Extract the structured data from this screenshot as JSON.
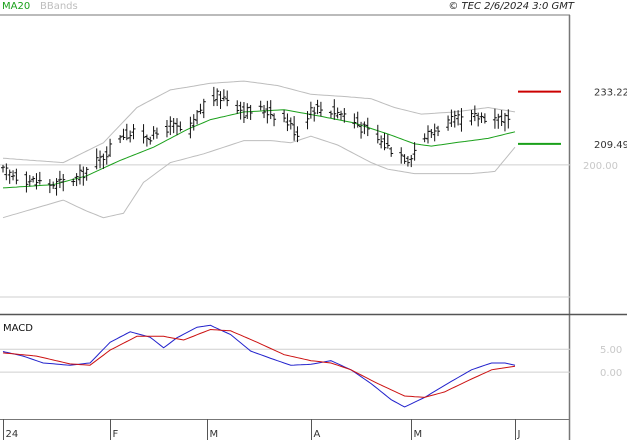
{
  "header": {
    "legend_ma": "MA20",
    "legend_bb": "BBands",
    "timestamp": "© TEC 2/6/2024 3:0 GMT"
  },
  "colors": {
    "ma": "#1aa01a",
    "bbands": "#bdbdbd",
    "price_bar": "#111111",
    "resistance": "#cc0000",
    "support": "#1aa01a",
    "macd_line": "#2222cc",
    "signal_line": "#cc1111",
    "grid": "#cfcfcf",
    "frame": "#777777"
  },
  "chart_data": [
    {
      "type": "ohlc",
      "title": "",
      "ylim": [
        140,
        268
      ],
      "y_ticks": [
        {
          "value": 200,
          "label": "200.00"
        }
      ],
      "x_ticks": [
        {
          "day": 0,
          "label": "24"
        },
        {
          "day": 32,
          "label": "F"
        },
        {
          "day": 61,
          "label": "M"
        },
        {
          "day": 92,
          "label": "A"
        },
        {
          "day": 122,
          "label": "M"
        },
        {
          "day": 153,
          "label": "J"
        }
      ],
      "levels": [
        {
          "name": "resistance",
          "value": 233.22,
          "label": "233.22"
        },
        {
          "name": "support",
          "value": 209.49,
          "label": "209.49"
        }
      ],
      "close_path": [
        [
          0,
          197
        ],
        [
          8,
          193
        ],
        [
          15,
          191
        ],
        [
          22,
          194
        ],
        [
          30,
          204
        ],
        [
          35,
          214
        ],
        [
          40,
          214
        ],
        [
          45,
          213
        ],
        [
          50,
          218
        ],
        [
          55,
          214
        ],
        [
          60,
          228
        ],
        [
          64,
          231
        ],
        [
          68,
          230
        ],
        [
          72,
          224
        ],
        [
          78,
          225
        ],
        [
          84,
          221
        ],
        [
          88,
          214
        ],
        [
          92,
          226
        ],
        [
          97,
          225
        ],
        [
          102,
          223
        ],
        [
          108,
          216
        ],
        [
          114,
          209
        ],
        [
          121,
          203
        ],
        [
          126,
          213
        ],
        [
          132,
          219
        ],
        [
          138,
          221
        ],
        [
          144,
          222
        ],
        [
          150,
          221
        ],
        [
          153,
          217
        ]
      ],
      "ma20_path": [
        [
          0,
          189.5
        ],
        [
          15,
          191
        ],
        [
          25,
          195
        ],
        [
          35,
          202
        ],
        [
          45,
          208
        ],
        [
          55,
          216
        ],
        [
          62,
          220.5
        ],
        [
          72,
          224
        ],
        [
          84,
          225
        ],
        [
          95,
          222
        ],
        [
          105,
          219
        ],
        [
          115,
          214
        ],
        [
          123,
          209.5
        ],
        [
          128,
          208.5
        ],
        [
          135,
          210
        ],
        [
          145,
          212
        ],
        [
          153,
          215
        ]
      ],
      "bb_upper_path": [
        [
          0,
          203
        ],
        [
          18,
          201
        ],
        [
          30,
          210
        ],
        [
          40,
          226
        ],
        [
          50,
          234
        ],
        [
          62,
          237
        ],
        [
          72,
          238
        ],
        [
          82,
          236
        ],
        [
          92,
          232
        ],
        [
          102,
          231
        ],
        [
          110,
          230
        ],
        [
          117,
          226
        ],
        [
          125,
          223
        ],
        [
          135,
          224
        ],
        [
          145,
          226
        ],
        [
          153,
          224
        ]
      ],
      "bb_lower_path": [
        [
          0,
          176
        ],
        [
          18,
          184
        ],
        [
          25,
          179
        ],
        [
          30,
          176
        ],
        [
          36,
          178
        ],
        [
          42,
          192
        ],
        [
          50,
          201
        ],
        [
          60,
          205
        ],
        [
          72,
          211
        ],
        [
          80,
          211
        ],
        [
          86,
          210
        ],
        [
          92,
          213
        ],
        [
          100,
          209
        ],
        [
          110,
          201
        ],
        [
          115,
          198
        ],
        [
          123,
          196
        ],
        [
          130,
          196
        ],
        [
          140,
          196
        ],
        [
          147,
          197
        ],
        [
          153,
          208
        ]
      ]
    },
    {
      "type": "line",
      "title": "MACD",
      "ylim": [
        -1000,
        1180
      ],
      "y_ticks": [
        {
          "value": 500,
          "label": "5.00"
        },
        {
          "value": 0,
          "label": "0.00"
        }
      ],
      "series": [
        {
          "name": "macd",
          "points": [
            [
              0,
              450
            ],
            [
              6,
              350
            ],
            [
              12,
              200
            ],
            [
              20,
              150
            ],
            [
              26,
              200
            ],
            [
              32,
              650
            ],
            [
              38,
              880
            ],
            [
              44,
              760
            ],
            [
              48,
              530
            ],
            [
              52,
              750
            ],
            [
              58,
              980
            ],
            [
              62,
              1020
            ],
            [
              68,
              820
            ],
            [
              74,
              460
            ],
            [
              80,
              300
            ],
            [
              86,
              150
            ],
            [
              92,
              170
            ],
            [
              98,
              250
            ],
            [
              104,
              50
            ],
            [
              110,
              -250
            ],
            [
              116,
              -600
            ],
            [
              120,
              -760
            ],
            [
              126,
              -550
            ],
            [
              134,
              -200
            ],
            [
              140,
              50
            ],
            [
              146,
              200
            ],
            [
              150,
              200
            ],
            [
              153,
              150
            ]
          ]
        },
        {
          "name": "signal",
          "points": [
            [
              0,
              420
            ],
            [
              10,
              350
            ],
            [
              20,
              180
            ],
            [
              26,
              150
            ],
            [
              32,
              480
            ],
            [
              40,
              780
            ],
            [
              48,
              780
            ],
            [
              54,
              700
            ],
            [
              62,
              930
            ],
            [
              68,
              900
            ],
            [
              76,
              650
            ],
            [
              84,
              380
            ],
            [
              92,
              250
            ],
            [
              98,
              200
            ],
            [
              104,
              50
            ],
            [
              112,
              -250
            ],
            [
              120,
              -520
            ],
            [
              126,
              -550
            ],
            [
              132,
              -430
            ],
            [
              140,
              -150
            ],
            [
              146,
              50
            ],
            [
              153,
              130
            ]
          ]
        }
      ]
    }
  ]
}
